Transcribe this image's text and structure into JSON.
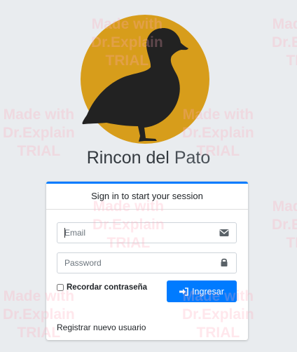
{
  "brand": {
    "name_part1": "Rincon del",
    "name_part2": "Pato"
  },
  "login_card": {
    "header": "Sign in to start your session",
    "email_placeholder": "Email",
    "password_placeholder": "Password",
    "remember_label": "Recordar contraseña",
    "submit_label": "Ingresar",
    "register_link": "Registrar nuevo usuario"
  },
  "watermark": {
    "line1": "Made with",
    "line2": "Dr.Explain",
    "line3": "TRIAL"
  },
  "colors": {
    "accent": "#007bff",
    "logo_circle": "#d79d1b",
    "duck": "#222222",
    "background": "#e9ecef"
  },
  "icons": {
    "email": "envelope-icon",
    "password": "lock-icon",
    "submit": "sign-in-icon",
    "logo": "duck-logo"
  }
}
